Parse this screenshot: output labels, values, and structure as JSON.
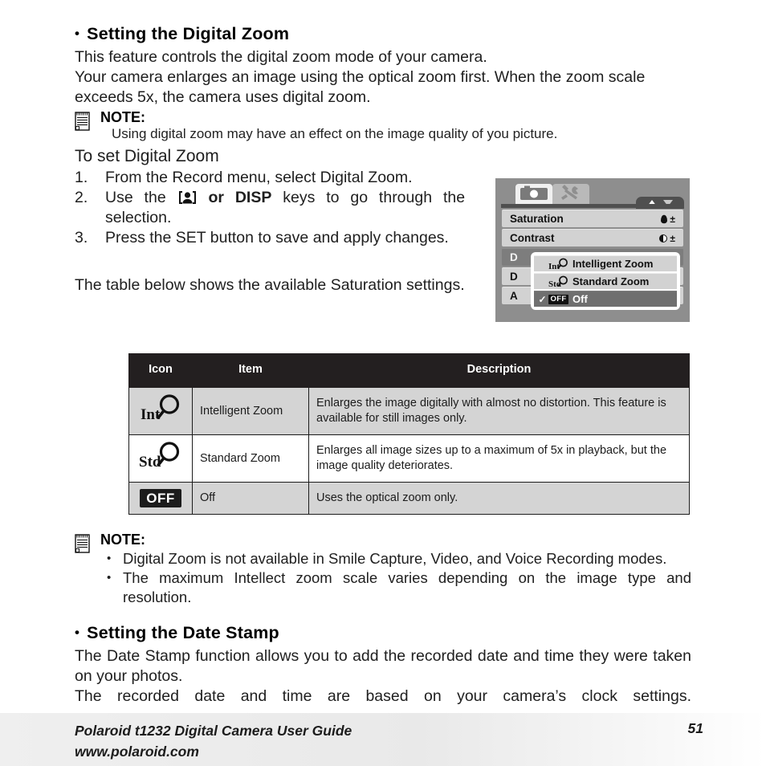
{
  "document": {
    "section1": {
      "bullet": "•",
      "heading": "Setting the Digital Zoom",
      "para1": "This feature controls the digital zoom mode of your camera.",
      "para2": "Your camera enlarges an image using the optical zoom first. When the zoom scale exceeds 5x, the camera uses digital zoom.",
      "note": {
        "title": "NOTE:",
        "line": "Using digital zoom may have an effect on the image quality of you picture."
      },
      "subheading": "To set Digital Zoom",
      "steps": [
        {
          "num": "1.",
          "text_before": "From the Record menu, select Digital Zoom.",
          "text_after": ""
        },
        {
          "num": "2.",
          "text_before": "Use the",
          "key_icon": "face-key-icon",
          "text_mid": "or",
          "key_label": "DISP",
          "text_after": "keys to go through the selection."
        },
        {
          "num": "3.",
          "text_before": "Press the SET button to save and apply changes.",
          "text_after": ""
        }
      ],
      "table_intro": "The table below shows the available Saturation settings."
    },
    "table": {
      "headers": [
        "Icon",
        "Item",
        "Description"
      ],
      "rows": [
        {
          "icon": "intelligent-zoom-icon",
          "icon_text": "Int",
          "item": "Intelligent Zoom",
          "description": "Enlarges the image digitally with almost no distortion. This feature is available for still images only."
        },
        {
          "icon": "standard-zoom-icon",
          "icon_text": "Std",
          "item": "Standard Zoom",
          "description": "Enlarges all image sizes up to a maximum of 5x in playback, but the image quality deteriorates."
        },
        {
          "icon": "off-icon",
          "icon_text": "OFF",
          "item": "Off",
          "description": "Uses the optical zoom only."
        }
      ]
    },
    "note2": {
      "title": "NOTE:",
      "bullets": [
        "Digital Zoom is not available in Smile Capture, Video, and Voice Recording modes.",
        "The maximum Intellect zoom scale varies depending on the image type and resolution."
      ]
    },
    "section2": {
      "bullet": "•",
      "heading": "Setting the Date Stamp",
      "para1": "The Date Stamp function allows you to add the recorded date and time they were taken on your photos.",
      "para2": "The recorded date and time are based on your camera’s clock settings."
    },
    "footer": {
      "line1": "Polaroid t1232 Digital Camera User Guide",
      "line2": "www.polaroid.com",
      "page": "51"
    }
  },
  "camera_screen": {
    "tabs": [
      {
        "name": "record-tab",
        "icon": "camera-icon",
        "active": true
      },
      {
        "name": "setup-tab",
        "icon": "wrench-icon",
        "active": false
      }
    ],
    "scroll_indicator": {
      "up": "▲",
      "down": "▼"
    },
    "menu_rows": [
      {
        "label": "Saturation",
        "value_icon": "droplet-plusminus-icon",
        "value": "±",
        "selected": false
      },
      {
        "label": "Contrast",
        "value_icon": "contrast-plusminus-icon",
        "value": "±",
        "selected": false
      },
      {
        "label": "D",
        "value": "",
        "selected": true
      },
      {
        "label": "D",
        "value": "",
        "selected": false
      },
      {
        "label": "A",
        "value": "",
        "selected": false
      }
    ],
    "popup": {
      "items": [
        {
          "icon_text": "Int",
          "label": "Intelligent Zoom",
          "checked": false
        },
        {
          "icon_text": "Std",
          "label": "Standard Zoom",
          "checked": false
        },
        {
          "icon_text": "OFF",
          "label": "Off",
          "checked": true,
          "check_glyph": "✓"
        }
      ]
    }
  },
  "colors": {
    "table_header_bg": "#231f20",
    "table_shade": "#d4d4d4",
    "lcd_bg": "#8e8e8e",
    "lcd_row": "#d2d2d2",
    "lcd_selected": "#7d7d7d",
    "text": "#202020"
  }
}
